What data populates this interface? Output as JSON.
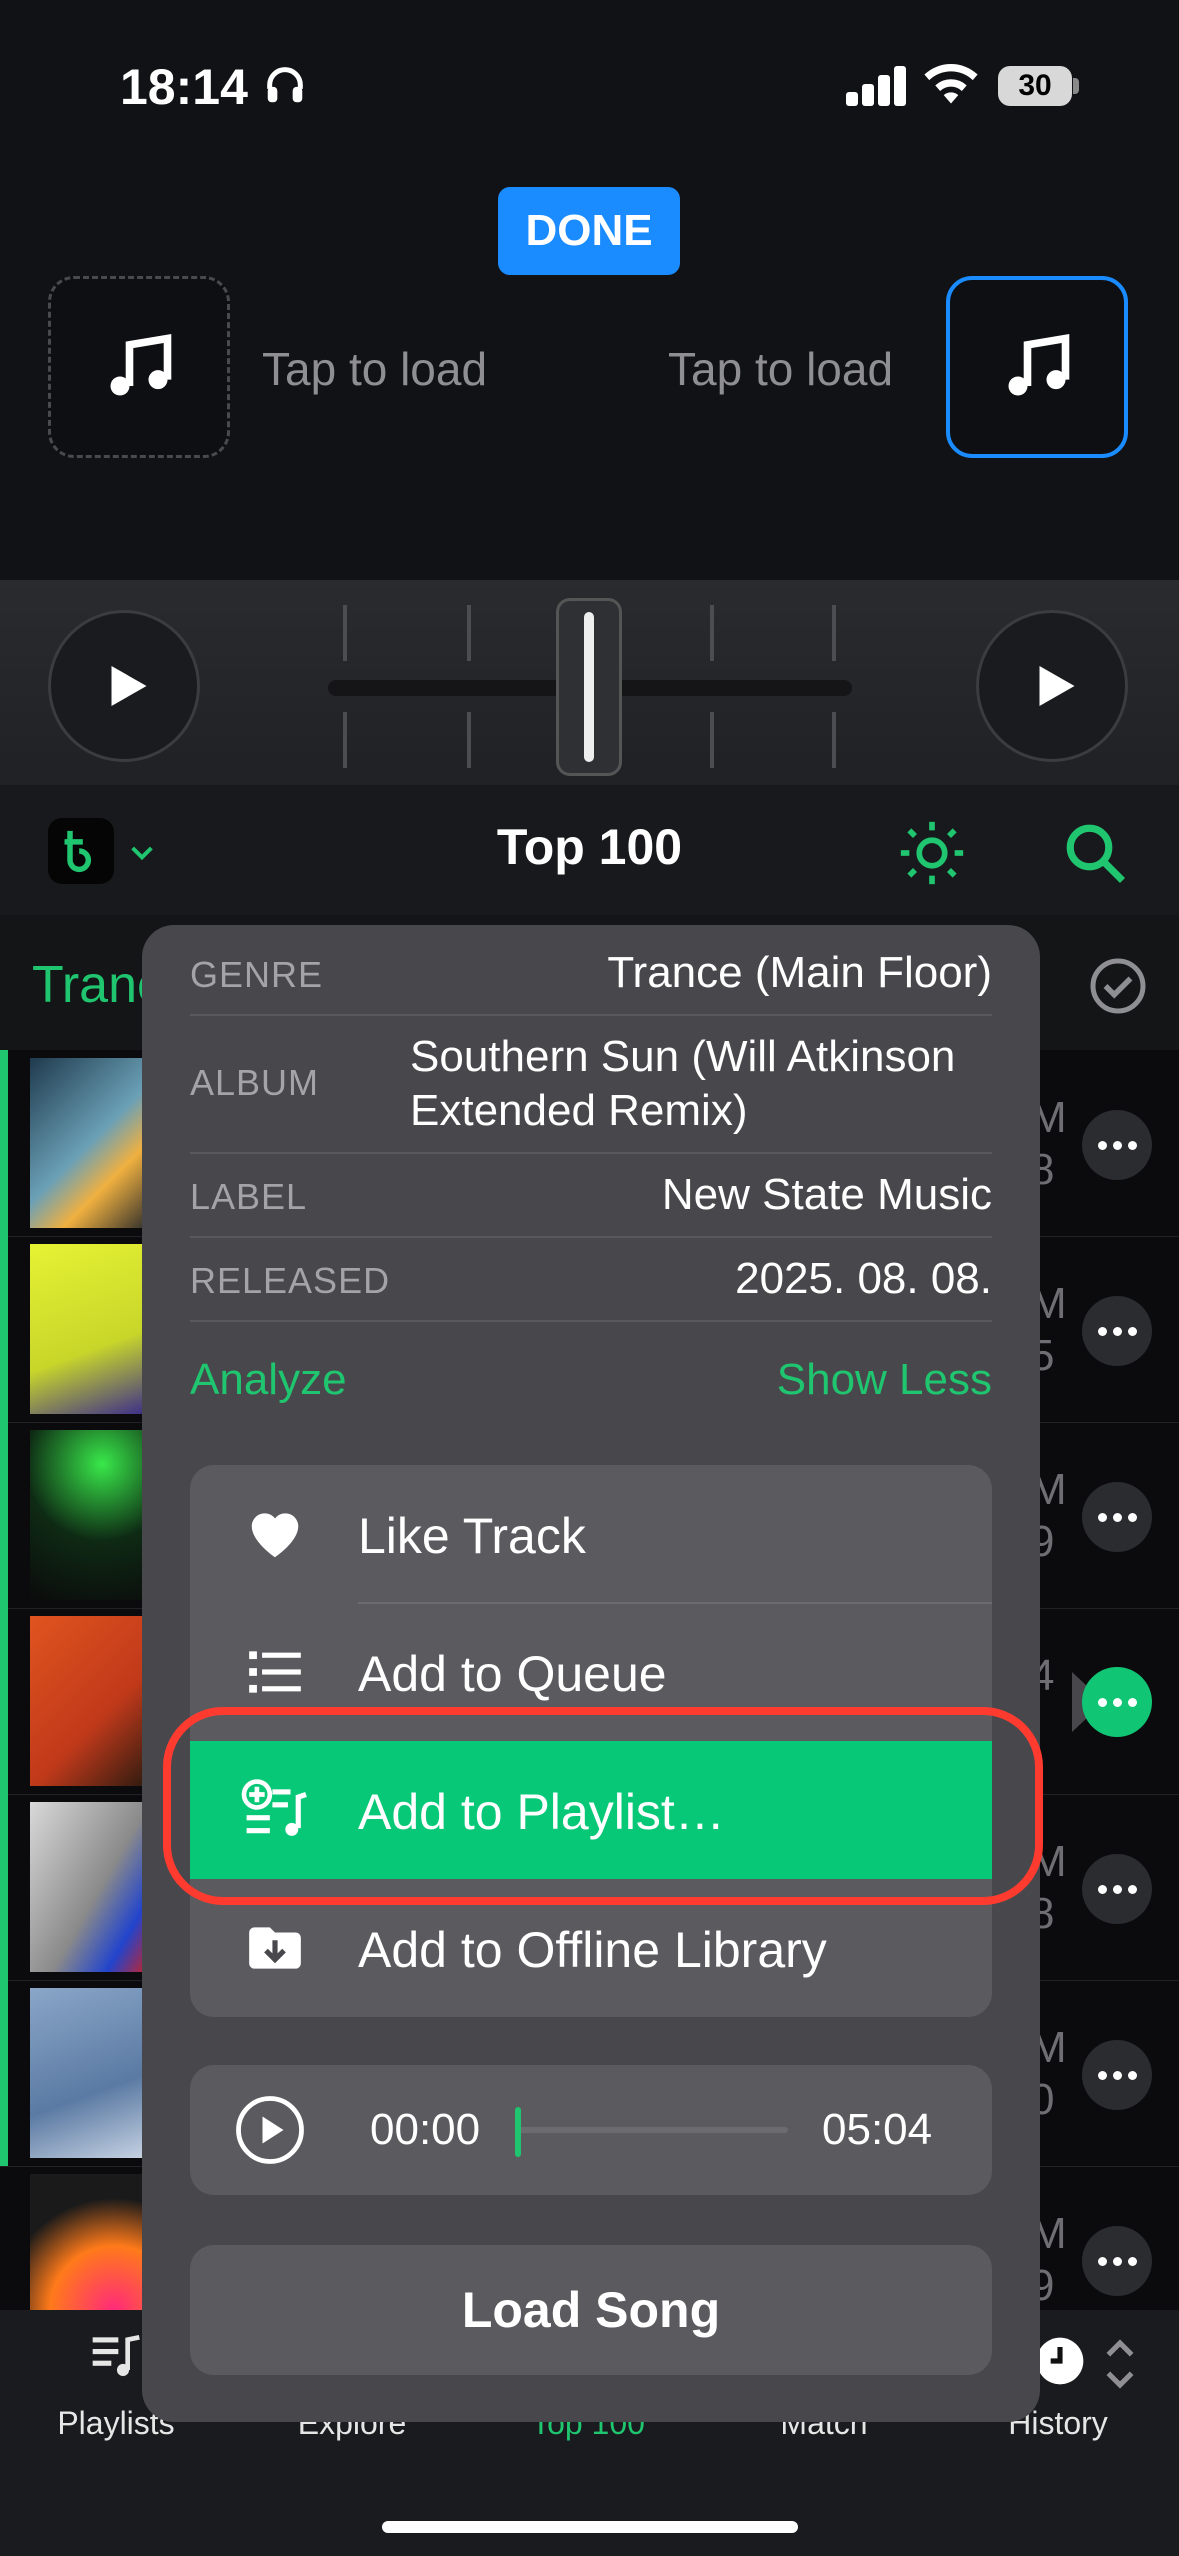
{
  "status": {
    "time": "18:14",
    "battery": "30"
  },
  "decks": {
    "done_label": "DONE",
    "left_label": "Tap to load",
    "right_label": "Tap to load"
  },
  "header": {
    "title": "Top 100"
  },
  "filter": {
    "label": "Trance"
  },
  "rows": [
    {
      "meta": [
        "M",
        "8"
      ]
    },
    {
      "meta": [
        "M",
        "5"
      ]
    },
    {
      "meta": [
        "M",
        "9"
      ]
    },
    {
      "meta": [
        "",
        "4"
      ]
    },
    {
      "meta": [
        "M",
        "8"
      ]
    },
    {
      "meta": [
        "M",
        "0"
      ]
    },
    {
      "meta": [
        "M",
        "9"
      ]
    }
  ],
  "track_info": {
    "genre": {
      "key": "GENRE",
      "value": "Trance (Main Floor)"
    },
    "album": {
      "key": "ALBUM",
      "value_line1": "Southern Sun (Will Atkinson",
      "value_line2": "Extended Remix)"
    },
    "label": {
      "key": "LABEL",
      "value": "New State Music"
    },
    "released": {
      "key": "RELEASED",
      "value": "2025. 08. 08."
    },
    "analyze": "Analyze",
    "show_less": "Show Less"
  },
  "menu": {
    "like": "Like Track",
    "queue": "Add to Queue",
    "playlist": "Add to Playlist…",
    "offline": "Add to Offline Library"
  },
  "player": {
    "current": "00:00",
    "duration": "05:04",
    "progress": 0.0
  },
  "load_song": "Load Song",
  "tabs": {
    "playlists": "Playlists",
    "explore": "Explore",
    "top100": "Top 100",
    "match": "Match",
    "history": "History"
  },
  "colors": {
    "accent": "#1fc56f",
    "highlight": "#07c877",
    "annotation": "#ff3b30",
    "deck_active": "#1a8cff"
  }
}
